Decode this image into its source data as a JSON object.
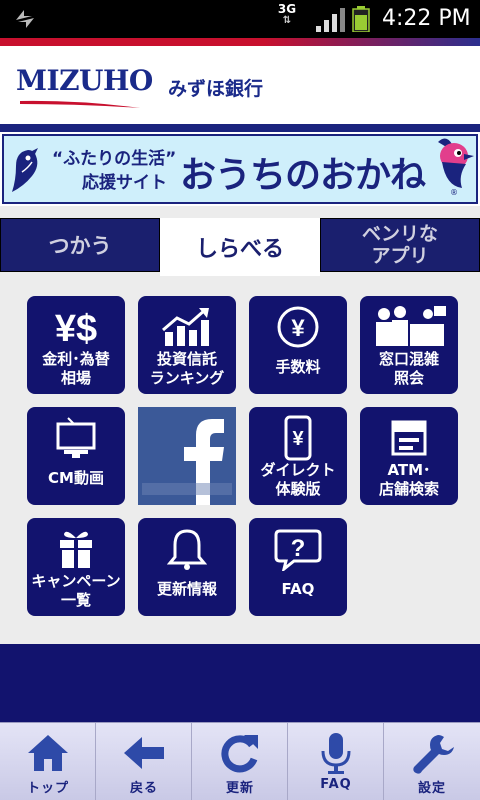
{
  "status_bar": {
    "network": "3G",
    "time": "4:22 PM"
  },
  "header": {
    "logo_en": "MIZUHO",
    "logo_jp": "みずほ銀行"
  },
  "banner": {
    "subtitle_line1": "“ふたりの生活”",
    "subtitle_line2": "応援サイト",
    "title": "おうちのおかね",
    "mark": "®"
  },
  "tabs": [
    {
      "label": "つかう"
    },
    {
      "label": "しらべる"
    },
    {
      "label_line1": "ベンリな",
      "label_line2": "アプリ"
    }
  ],
  "tiles": [
    {
      "icon": "yen-dollar-icon",
      "line1": "金利･為替",
      "line2": "相場"
    },
    {
      "icon": "chart-up-icon",
      "line1": "投資信託",
      "line2": "ランキング"
    },
    {
      "icon": "yen-coin-icon",
      "line1": "手数料",
      "line2": ""
    },
    {
      "icon": "counter-people-icon",
      "line1": "窓口混雑",
      "line2": "照会"
    },
    {
      "icon": "tv-icon",
      "line1": "CM動画",
      "line2": ""
    },
    {
      "icon": "facebook-icon",
      "line1": "",
      "line2": ""
    },
    {
      "icon": "phone-yen-icon",
      "line1": "ダイレクト",
      "line2": "体験版"
    },
    {
      "icon": "atm-icon",
      "line1": "ATM･",
      "line2": "店舗検索"
    },
    {
      "icon": "gift-icon",
      "line1": "キャンペーン",
      "line2": "一覧"
    },
    {
      "icon": "bell-icon",
      "line1": "更新情報",
      "line2": ""
    },
    {
      "icon": "question-bubble-icon",
      "line1": "FAQ",
      "line2": ""
    }
  ],
  "bottom_nav": [
    {
      "icon": "home-icon",
      "label": "トップ"
    },
    {
      "icon": "back-arrow-icon",
      "label": "戻る"
    },
    {
      "icon": "refresh-icon",
      "label": "更新"
    },
    {
      "icon": "microphone-icon",
      "label": "FAQ"
    },
    {
      "icon": "wrench-icon",
      "label": "設定"
    }
  ],
  "colors": {
    "navy": "#12136e",
    "accent_red": "#c8102e",
    "facebook": "#3b5998",
    "banner_bg": "#cfeffb"
  }
}
